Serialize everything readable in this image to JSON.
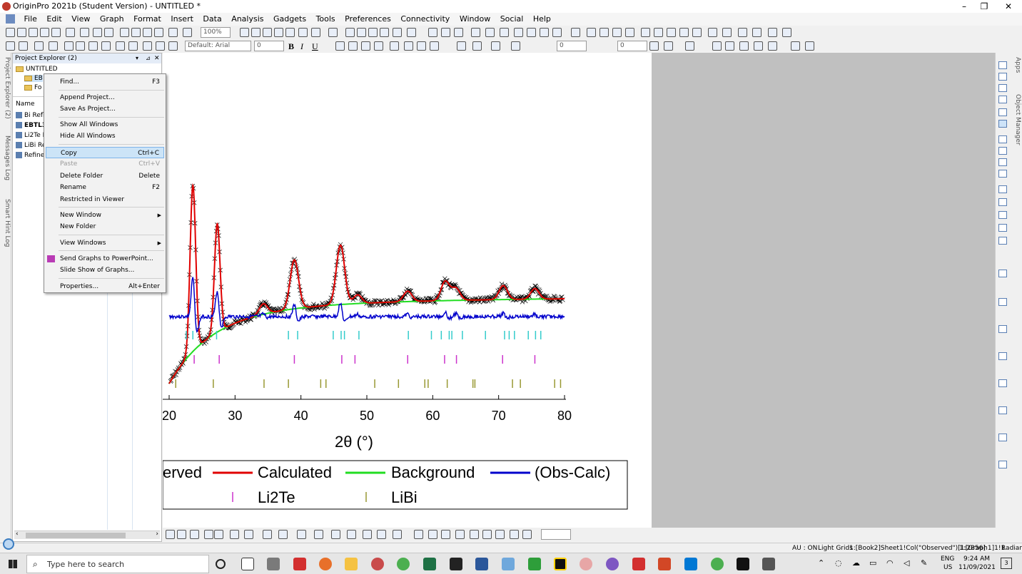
{
  "window": {
    "title": "OriginPro 2021b (Student Version) - UNTITLED *",
    "min_glyph": "–",
    "restore_glyph": "❐",
    "close_glyph": "✕"
  },
  "menu": [
    "File",
    "Edit",
    "View",
    "Graph",
    "Format",
    "Insert",
    "Data",
    "Analysis",
    "Gadgets",
    "Tools",
    "Preferences",
    "Connectivity",
    "Window",
    "Social",
    "Help"
  ],
  "toolbar": {
    "zoom_value": "100%",
    "font_value": "Default: Arial",
    "font_size_value": "0",
    "line_width_value": "0",
    "fill_value": "0",
    "bold": "B",
    "italic": "I",
    "underline": "U"
  },
  "left_tabs": [
    "Project Explorer (2)",
    "Messages Log",
    "Smart Hint Log"
  ],
  "right_tabs": [
    "Apps",
    "Object Manager"
  ],
  "project_explorer": {
    "header": "Project Explorer (2)",
    "root": "UNTITLED",
    "folders": [
      "EB",
      "Fo"
    ],
    "name_column": "Name",
    "items": [
      "Bi Refl",
      "EBTL3",
      "Li2Te R",
      "LiBi Re",
      "Refine"
    ]
  },
  "context_menu": {
    "items": [
      {
        "label": "Find...",
        "shortcut": "F3"
      },
      {
        "label": "Append Project...",
        "shortcut": ""
      },
      {
        "label": "Save As Project...",
        "shortcut": ""
      },
      {
        "label": "Show All Windows",
        "shortcut": ""
      },
      {
        "label": "Hide All Windows",
        "shortcut": ""
      },
      {
        "label": "Copy",
        "shortcut": "Ctrl+C"
      },
      {
        "label": "Paste",
        "shortcut": "Ctrl+V"
      },
      {
        "label": "Delete Folder",
        "shortcut": "Delete"
      },
      {
        "label": "Rename",
        "shortcut": "F2"
      },
      {
        "label": "Restricted in Viewer",
        "shortcut": ""
      },
      {
        "label": "New Window",
        "shortcut": ""
      },
      {
        "label": "New Folder",
        "shortcut": ""
      },
      {
        "label": "View Windows",
        "shortcut": ""
      },
      {
        "label": "Send Graphs to PowerPoint...",
        "shortcut": ""
      },
      {
        "label": "Slide Show of Graphs...",
        "shortcut": ""
      },
      {
        "label": "Properties...",
        "shortcut": "Alt+Enter"
      }
    ]
  },
  "chart_data": {
    "type": "line",
    "xlabel": "2θ (°)",
    "xlim": [
      20,
      80
    ],
    "xticks": [
      "20",
      "30",
      "40",
      "50",
      "60",
      "70",
      "80"
    ],
    "colors": {
      "observed": "#000000",
      "calculated": "#e00000",
      "background": "#22dd22",
      "difference": "#0000cc",
      "tick1": "#33cccc",
      "tick2": "#cc33cc",
      "tick3": "#999933"
    },
    "legend": {
      "row1": [
        "erved",
        "Calculated",
        "Background",
        "(Obs-Calc)"
      ],
      "row2": [
        "Li2Te",
        "LiBi"
      ]
    },
    "reflections": {
      "row_cyan": [
        22.6,
        23.6,
        27.2,
        38.1,
        39.5,
        44.9,
        46.1,
        46.6,
        48.8,
        56.3,
        59.8,
        61.3,
        62.5,
        62.9,
        64.5,
        68.0,
        70.9,
        71.6,
        72.4,
        74.5,
        75.6,
        76.4
      ],
      "row_magenta": [
        23.8,
        27.6,
        39.0,
        46.2,
        48.2,
        56.2,
        61.8,
        63.6,
        70.6,
        75.5
      ],
      "row_olive": [
        21.0,
        26.7,
        34.4,
        38.1,
        43.0,
        43.8,
        51.2,
        54.8,
        58.8,
        59.3,
        62.2,
        66.1,
        66.4,
        72.1,
        73.3,
        78.5,
        79.4
      ]
    },
    "peaks": [
      {
        "x": 23.6,
        "height": 0.95
      },
      {
        "x": 27.3,
        "height": 0.62
      },
      {
        "x": 34.3,
        "height": 0.06
      },
      {
        "x": 39.0,
        "height": 0.28
      },
      {
        "x": 46.0,
        "height": 0.34
      },
      {
        "x": 48.6,
        "height": 0.05
      },
      {
        "x": 56.2,
        "height": 0.06
      },
      {
        "x": 61.9,
        "height": 0.11
      },
      {
        "x": 63.5,
        "height": 0.07
      },
      {
        "x": 70.7,
        "height": 0.08
      },
      {
        "x": 75.5,
        "height": 0.06
      }
    ]
  },
  "status": {
    "au": "AU : ON",
    "grid": "Light Grids",
    "book": "1:[Book2]Sheet1!Col(\"Observed\")[1:2856]",
    "graph": "1:[Graph1]1!1",
    "unit": "Radian"
  },
  "taskbar": {
    "search_placeholder": "Type here to search",
    "lang": "ENG",
    "region": "US",
    "time": "9:24 AM",
    "date": "11/09/2021",
    "notif_count": "3"
  }
}
